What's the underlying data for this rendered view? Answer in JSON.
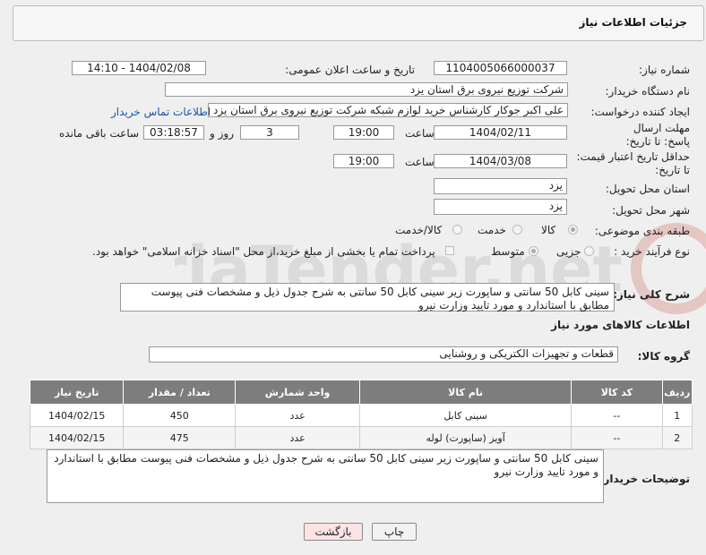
{
  "header": {
    "title": "جزئیات اطلاعات نیاز"
  },
  "labels": {
    "need_number": "شماره نیاز:",
    "announce_datetime": "تاریخ و ساعت اعلان عمومی:",
    "buyer_org": "نام دستگاه خریدار:",
    "requester": "ایجاد کننده درخواست:",
    "contact_link": "اطلاعات تماس خریدار",
    "reply_deadline": "مهلت ارسال پاسخ: تا تاریخ:",
    "time_word": "ساعت",
    "day_and": "روز و",
    "remaining": "ساعت باقی مانده",
    "price_validity": "حداقل تاریخ اعتبار قیمت: تا تاریخ:",
    "province": "استان محل تحویل:",
    "city": "شهر محل تحویل:",
    "category": "طبقه بندی موضوعی:",
    "process_type": "نوع فرآیند خرید :",
    "general_desc": "شرح کلی نیاز:",
    "goods_info": "اطلاعات کالاهای مورد نیاز",
    "goods_group": "گروه کالا:",
    "buyer_notes": "توضیحات خریدار:"
  },
  "values": {
    "need_number": "1104005066000037",
    "announce_datetime": "1404/02/08 - 14:10",
    "buyer_org": "شرکت توزیع نیروی برق استان یزد",
    "requester": "علی اکبر جوکار  کارشناس خرید لوازم شبکه  شرکت توزیع نیروی برق استان یزد",
    "reply_date": "1404/02/11",
    "reply_time": "19:00",
    "reply_days": "3",
    "remaining_time": "03:18:57",
    "price_date": "1404/03/08",
    "price_time": "19:00",
    "province": "یزد",
    "city": "یزد",
    "general_desc": "سینی کابل 50 سانتی و ساپورت زیر سینی کابل 50 سانتی  به شرح جدول ذیل و مشخصات فنی پیوست مطابق با استاندارد و مورد تایید وزارت نیرو",
    "goods_group": "قطعات و تجهیزات الکتریکی و روشنایی",
    "buyer_notes": "سینی کابل 50 سانتی و ساپورت زیر سینی کابل 50 سانتی  به شرح جدول ذیل و مشخصات فنی پیوست مطابق با استاندارد و مورد تایید وزارت نیرو"
  },
  "category_options": [
    "کالا",
    "خدمت",
    "کالا/خدمت"
  ],
  "process_options": [
    "جزیی",
    "متوسط"
  ],
  "payment_note": "پرداخت تمام یا بخشی از مبلغ خرید،از محل \"اسناد خزانه اسلامی\" خواهد بود.",
  "table": {
    "headers": [
      "ردیف",
      "کد کالا",
      "نام کالا",
      "واحد شمارش",
      "تعداد / مقدار",
      "تاریخ نیاز"
    ],
    "rows": [
      [
        "1",
        "--",
        "سینی کابل",
        "عدد",
        "450",
        "1404/02/15"
      ],
      [
        "2",
        "--",
        "آویز (ساپورت) لوله",
        "عدد",
        "475",
        "1404/02/15"
      ]
    ]
  },
  "buttons": {
    "print": "چاپ",
    "back": "بازگشت"
  },
  "watermark_text": "AriaTender.net"
}
